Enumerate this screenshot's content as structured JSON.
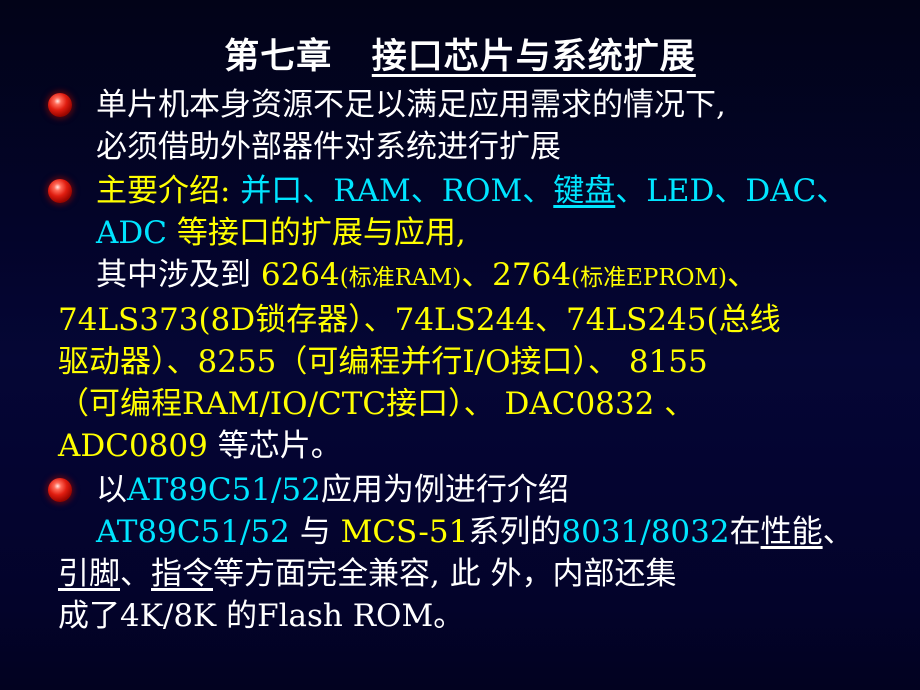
{
  "slide": {
    "background_top": "#020318",
    "background_mid": "#050635",
    "background_bottom": "#020220",
    "bullet_color": "#e01d10",
    "colors": {
      "white": "#ffffff",
      "yellow": "#ffff00",
      "cyan": "#00e5ff"
    }
  },
  "title": {
    "prefix": "第七章",
    "underlined": "接口芯片与系统扩展",
    "full": "第七章  接口芯片与系统扩展"
  },
  "bullets": [
    {
      "id": "bullet-1",
      "marker": "red-sphere-bullet",
      "lines": [
        {
          "id": "b1-l1",
          "runs": [
            {
              "text": "单片机本身资源不足以满足应用需求的情况下,",
              "color": "white"
            }
          ]
        },
        {
          "id": "b1-l2",
          "runs": [
            {
              "text": "必须借助外部器件对系统进行扩展",
              "color": "white"
            }
          ]
        }
      ]
    },
    {
      "id": "bullet-2",
      "marker": "red-sphere-bullet",
      "lines": [
        {
          "id": "b2-l1",
          "runs": [
            {
              "text": "主要介绍:",
              "color": "yellow"
            },
            {
              "text": " 并口、RAM、ROM、",
              "color": "cyan"
            },
            {
              "text": "键盘",
              "color": "cyan",
              "underline": true
            },
            {
              "text": "、LED、DAC、",
              "color": "cyan"
            }
          ]
        },
        {
          "id": "b2-l2",
          "runs": [
            {
              "text": "ADC",
              "color": "cyan"
            },
            {
              "text": " 等接口的扩展与应用,",
              "color": "yellow"
            }
          ]
        },
        {
          "id": "b2-l3",
          "runs": [
            {
              "text": "其中涉及到",
              "color": "white"
            },
            {
              "text": " 6264",
              "color": "yellow"
            },
            {
              "text": "(标准RAM)",
              "color": "yellow",
              "small": true
            },
            {
              "text": "、2764",
              "color": "yellow"
            },
            {
              "text": "(标准EPROM)",
              "color": "yellow",
              "small": true
            },
            {
              "text": "、",
              "color": "yellow"
            }
          ]
        },
        {
          "id": "b2-l4",
          "runs": [
            {
              "text": "74LS373(8D锁存器）、74LS244、74LS245(总线",
              "color": "yellow"
            }
          ]
        },
        {
          "id": "b2-l5",
          "runs": [
            {
              "text": "驱动器）、8255（可编程并行I/O接口）、 8155",
              "color": "yellow"
            }
          ]
        },
        {
          "id": "b2-l6",
          "runs": [
            {
              "text": "（可编程RAM/IO/CTC接口）、  DAC0832 、",
              "color": "yellow"
            }
          ]
        },
        {
          "id": "b2-l7",
          "runs": [
            {
              "text": "ADC0809",
              "color": "yellow"
            },
            {
              "text": " 等芯片。",
              "color": "white"
            }
          ]
        }
      ]
    },
    {
      "id": "bullet-3",
      "marker": "red-sphere-bullet",
      "lines": [
        {
          "id": "b3-l1",
          "runs": [
            {
              "text": "以",
              "color": "white"
            },
            {
              "text": "AT89C51/52",
              "color": "cyan"
            },
            {
              "text": "应用为例进行介绍",
              "color": "white"
            }
          ]
        },
        {
          "id": "b3-l2",
          "runs": [
            {
              "text": "AT89C51/52",
              "color": "cyan"
            },
            {
              "text": " 与 ",
              "color": "white"
            },
            {
              "text": "MCS-51",
              "color": "yellow"
            },
            {
              "text": "系列的",
              "color": "white"
            },
            {
              "text": "8031/8032",
              "color": "cyan"
            },
            {
              "text": "在",
              "color": "white"
            },
            {
              "text": "性能",
              "color": "white",
              "underline": true
            },
            {
              "text": "、",
              "color": "white"
            }
          ]
        },
        {
          "id": "b3-l3",
          "runs": [
            {
              "text": "引脚",
              "color": "white",
              "underline": true
            },
            {
              "text": "、",
              "color": "white"
            },
            {
              "text": "指令",
              "color": "white",
              "underline": true
            },
            {
              "text": "等方面完全兼容, 此 外，内部还集",
              "color": "white"
            }
          ]
        },
        {
          "id": "b3-l4",
          "runs": [
            {
              "text": "成了4K/8K 的Flash ROM。",
              "color": "white"
            }
          ]
        }
      ]
    }
  ]
}
